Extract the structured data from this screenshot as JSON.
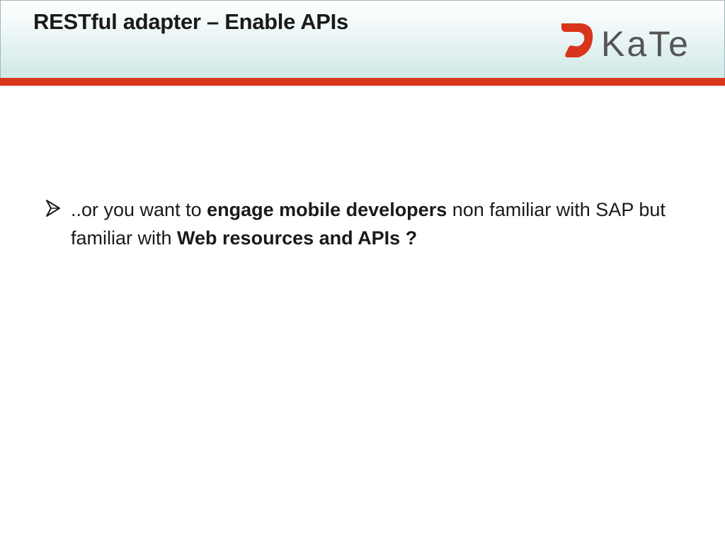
{
  "header": {
    "title": "RESTful adapter – Enable APIs",
    "logo_text": "KaTe"
  },
  "colors": {
    "accent_bar": "#d9341c",
    "logo_mark": "#d9341c",
    "logo_text": "#555555"
  },
  "bullets": [
    {
      "icon": "arrow-bullet-icon",
      "parts": [
        {
          "text": "..or you want to ",
          "bold": false
        },
        {
          "text": "engage mobile developers",
          "bold": true
        },
        {
          "text": " non familiar with SAP but familiar with ",
          "bold": false
        },
        {
          "text": "Web resources and APIs ?",
          "bold": true
        }
      ]
    }
  ]
}
